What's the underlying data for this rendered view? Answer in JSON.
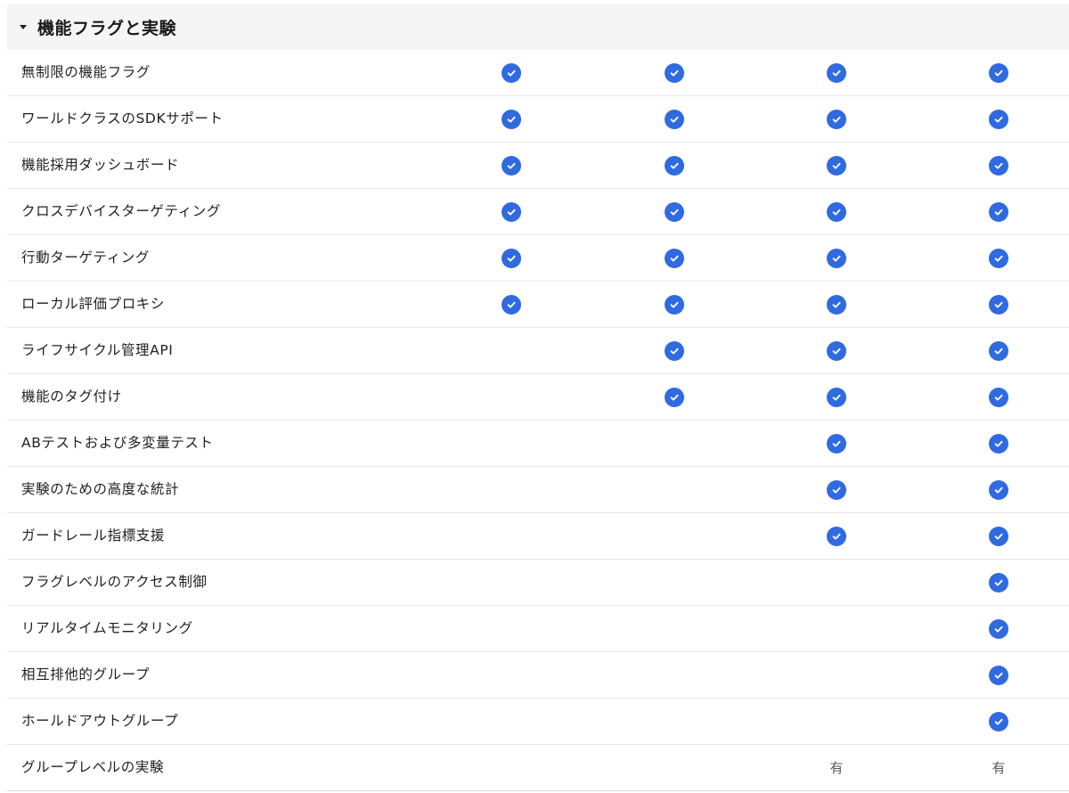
{
  "section": {
    "title": "機能フラグと実験",
    "expanded": true,
    "caret_icon": "caret-down-icon"
  },
  "colors": {
    "check": "#2f6ae0",
    "header_bg": "#f5f5f6",
    "divider": "#e6e6e9"
  },
  "rows": [
    {
      "label": "無制限の機能フラグ",
      "cells": [
        "check",
        "check",
        "check",
        "check"
      ]
    },
    {
      "label": "ワールドクラスのSDKサポート",
      "cells": [
        "check",
        "check",
        "check",
        "check"
      ]
    },
    {
      "label": "機能採用ダッシュボード",
      "cells": [
        "check",
        "check",
        "check",
        "check"
      ]
    },
    {
      "label": "クロスデバイスターゲティング",
      "cells": [
        "check",
        "check",
        "check",
        "check"
      ]
    },
    {
      "label": "行動ターゲティング",
      "cells": [
        "check",
        "check",
        "check",
        "check"
      ]
    },
    {
      "label": "ローカル評価プロキシ",
      "cells": [
        "check",
        "check",
        "check",
        "check"
      ]
    },
    {
      "label": "ライフサイクル管理API",
      "cells": [
        "",
        "check",
        "check",
        "check"
      ]
    },
    {
      "label": "機能のタグ付け",
      "cells": [
        "",
        "check",
        "check",
        "check"
      ]
    },
    {
      "label": "ABテストおよび多変量テスト",
      "cells": [
        "",
        "",
        "check",
        "check"
      ]
    },
    {
      "label": "実験のための高度な統計",
      "cells": [
        "",
        "",
        "check",
        "check"
      ]
    },
    {
      "label": "ガードレール指標支援",
      "cells": [
        "",
        "",
        "check",
        "check"
      ]
    },
    {
      "label": "フラグレベルのアクセス制御",
      "cells": [
        "",
        "",
        "",
        "check"
      ]
    },
    {
      "label": "リアルタイムモニタリング",
      "cells": [
        "",
        "",
        "",
        "check"
      ]
    },
    {
      "label": "相互排他的グループ",
      "cells": [
        "",
        "",
        "",
        "check"
      ]
    },
    {
      "label": "ホールドアウトグループ",
      "cells": [
        "",
        "",
        "",
        "check"
      ]
    },
    {
      "label": "グループレベルの実験",
      "cells": [
        "",
        "",
        "有",
        "有"
      ]
    }
  ]
}
